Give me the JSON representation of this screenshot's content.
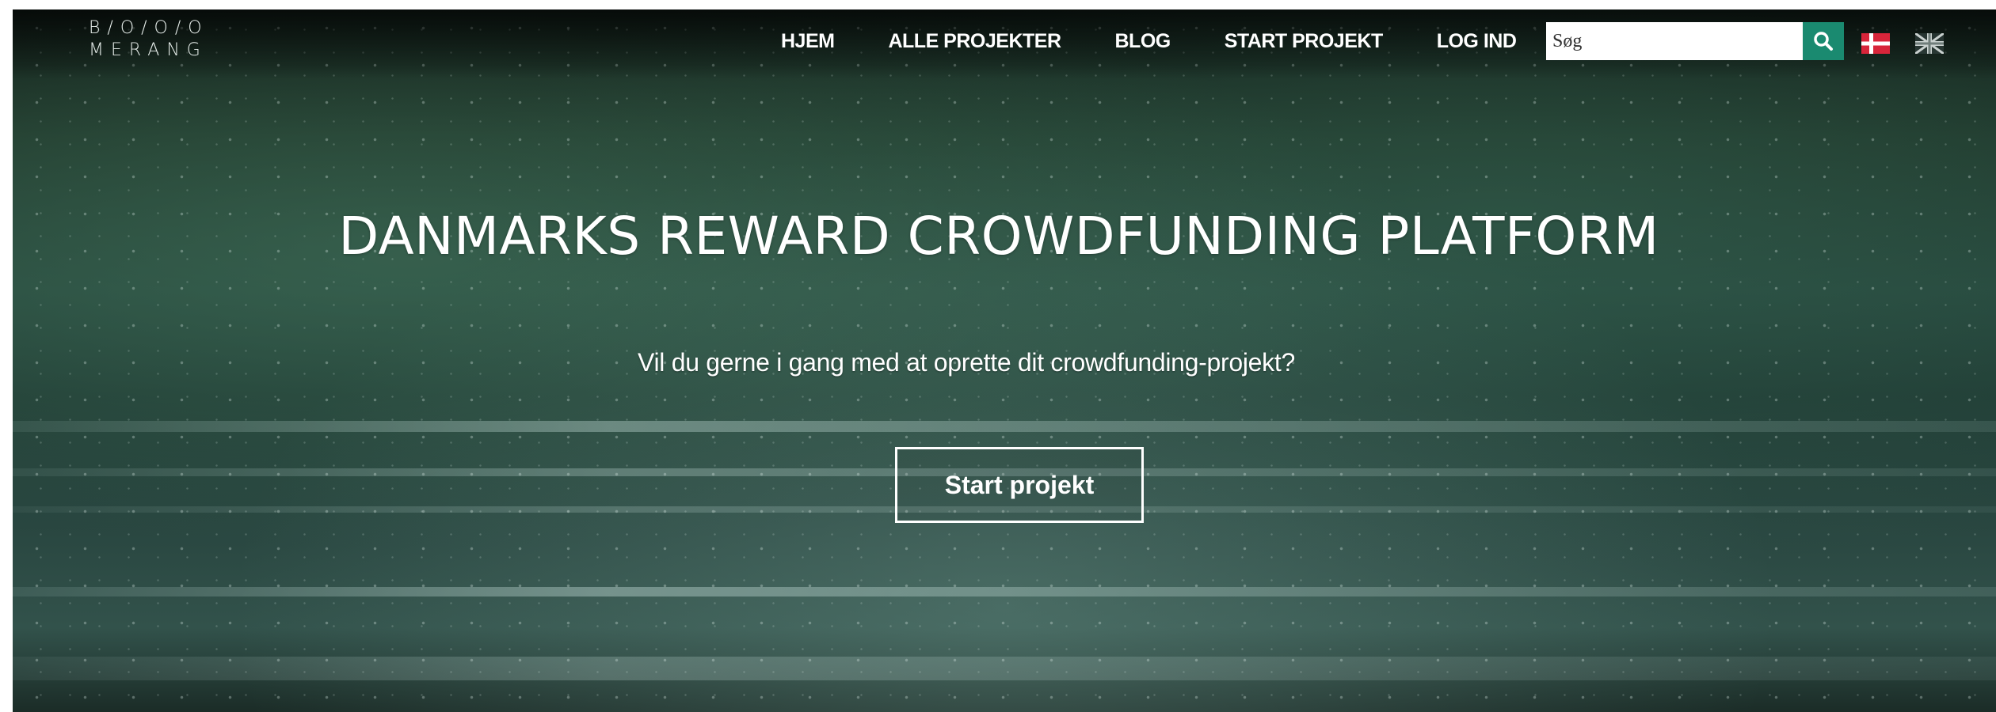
{
  "logo": {
    "line1": "B/O/O/O",
    "line2": "MERANG"
  },
  "nav": {
    "items": [
      {
        "label": "HJEM"
      },
      {
        "label": "ALLE PROJEKTER"
      },
      {
        "label": "BLOG"
      },
      {
        "label": "START PROJEKT"
      },
      {
        "label": "LOG IND"
      }
    ]
  },
  "search": {
    "placeholder": "Søg",
    "icon": "search-icon",
    "button_color": "#1a8a70"
  },
  "languages": {
    "items": [
      {
        "icon": "danish-flag-icon"
      },
      {
        "icon": "uk-flag-icon"
      }
    ]
  },
  "hero": {
    "title": "DANMARKS REWARD CROWDFUNDING PLATFORM",
    "subtitle": "Vil du gerne i gang med at oprette dit crowdfunding-projekt?",
    "cta_label": "Start projekt"
  }
}
